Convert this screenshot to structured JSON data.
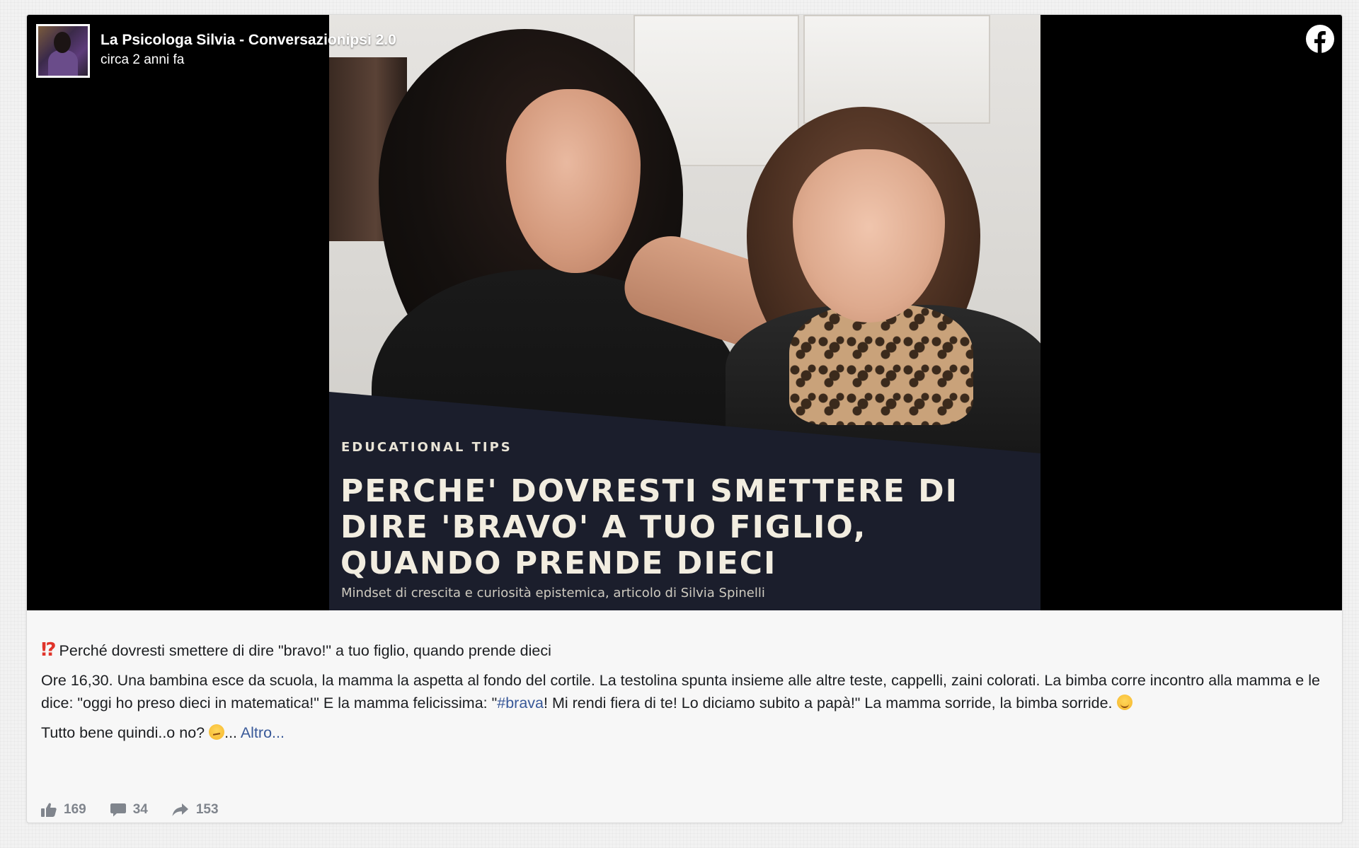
{
  "post": {
    "author": "La Psicologa Silvia - Conversazionipsi 2.0",
    "time": "circa 2 anni fa"
  },
  "image": {
    "kicker": "EDUCATIONAL TIPS",
    "headline": "PERCHE' DOVRESTI SMETTERE DI\nDIRE 'BRAVO' A TUO FIGLIO,\nQUANDO PRENDE DIECI",
    "subline": "Mindset di crescita e curiosità epistemica, articolo di Silvia Spinelli"
  },
  "body": {
    "headline_text": "Perché dovresti smettere di dire \"bravo!\" a tuo figlio, quando prende dieci",
    "para1_before_tag": "Ore 16,30. Una bambina esce da scuola, la mamma la aspetta al fondo del cortile. La testolina spunta insieme alle altre teste, cappelli, zaini colorati. La bimba corre incontro alla mamma e le dice: \"oggi ho preso dieci in matematica!\" E la mamma felicissima: \"",
    "hashtag": "#brava",
    "para1_after_tag": "! Mi rendi fiera di te! Lo diciamo subito a papà!\" La mamma sorride, la bimba sorride.",
    "para2_text": "Tutto bene quindi..o no?",
    "ellipsis": "...",
    "more_link": "Altro..."
  },
  "stats": {
    "likes": "169",
    "comments": "34",
    "shares": "153"
  },
  "icons": {
    "logo": "facebook-logo-icon",
    "like": "thumbs-up-icon",
    "comment": "comment-bubble-icon",
    "share": "share-arrow-icon"
  },
  "colors": {
    "link": "#385898",
    "stats": "#80858d",
    "banner": "#1b1e2c"
  }
}
